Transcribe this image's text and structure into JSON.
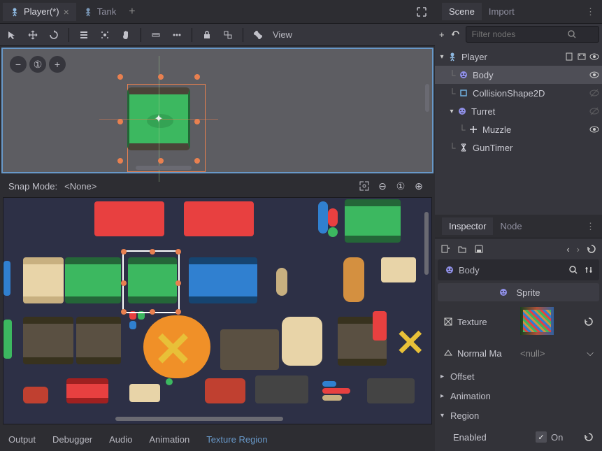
{
  "tabs": {
    "player": "Player(*)",
    "tank": "Tank"
  },
  "toolbar": {
    "view": "View"
  },
  "scene_dock": {
    "tabs": {
      "scene": "Scene",
      "import": "Import"
    },
    "filter_placeholder": "Filter nodes",
    "tree": {
      "player": "Player",
      "body": "Body",
      "collision": "CollisionShape2D",
      "turret": "Turret",
      "muzzle": "Muzzle",
      "guntimer": "GunTimer"
    }
  },
  "snap": {
    "label": "Snap Mode:",
    "value": "<None>"
  },
  "bottom": {
    "output": "Output",
    "debugger": "Debugger",
    "audio": "Audio",
    "animation": "Animation",
    "texture_region": "Texture Region"
  },
  "inspector": {
    "tabs": {
      "inspector": "Inspector",
      "node": "Node"
    },
    "node_name": "Body",
    "class_name": "Sprite",
    "props": {
      "texture": "Texture",
      "normal_map": "Normal Ma",
      "normal_map_val": "<null>"
    },
    "sections": {
      "offset": "Offset",
      "animation": "Animation",
      "region": "Region"
    },
    "region": {
      "enabled_label": "Enabled",
      "enabled_on": "On"
    }
  }
}
